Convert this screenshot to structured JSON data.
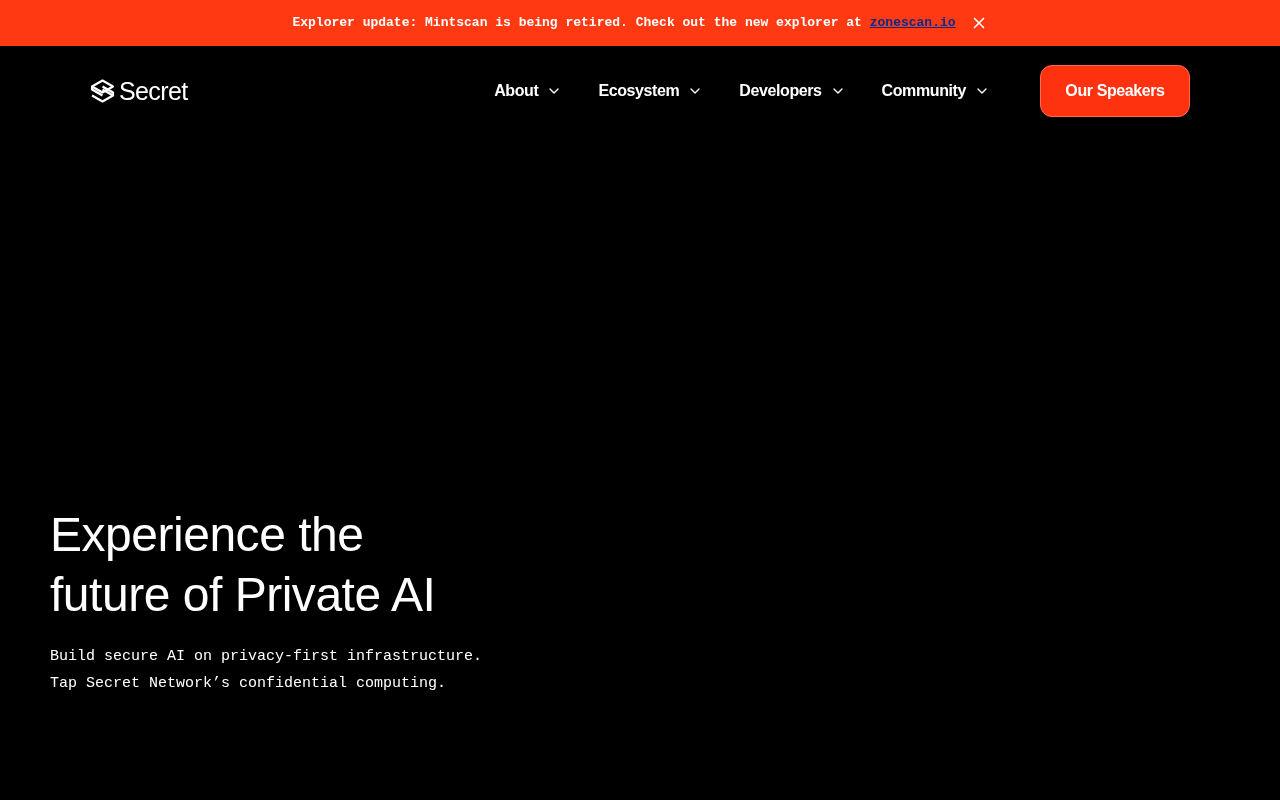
{
  "banner": {
    "message": "Explorer update: Mintscan is being retired. Check out the new explorer at",
    "link": "zonescan.io"
  },
  "header": {
    "brand": "Secret",
    "nav": [
      {
        "label": "About"
      },
      {
        "label": "Ecosystem"
      },
      {
        "label": "Developers"
      },
      {
        "label": "Community"
      }
    ],
    "cta": "Our Speakers"
  },
  "hero": {
    "heading_lines": [
      "Experience the",
      "future of Private AI"
    ],
    "subtitle_lines": [
      "Build secure AI on privacy-first infrastructure.",
      "Tap Secret Network’s confidential computing."
    ]
  }
}
